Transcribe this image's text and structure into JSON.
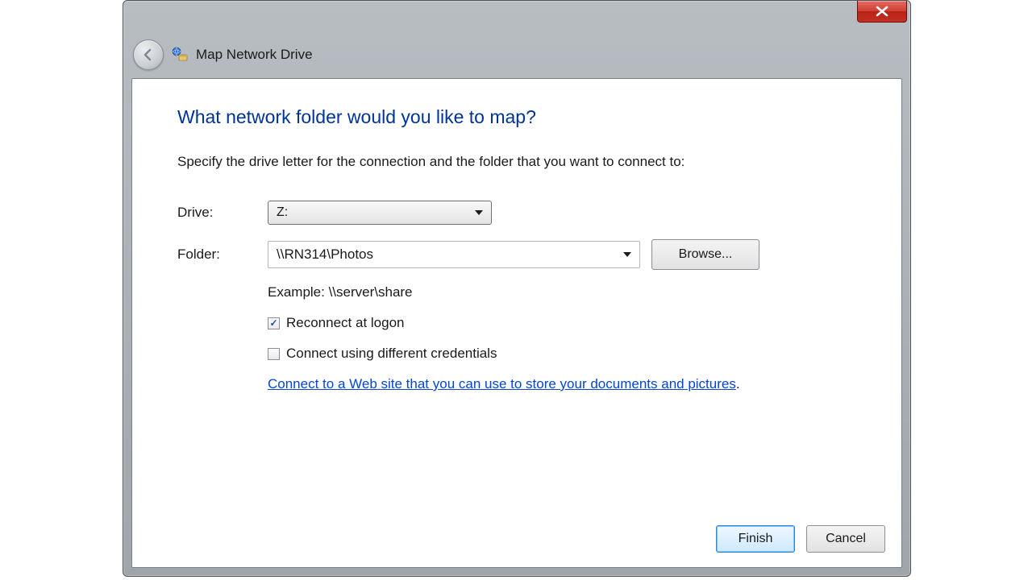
{
  "window": {
    "title": "Map Network Drive"
  },
  "content": {
    "heading": "What network folder would you like to map?",
    "instructions": "Specify the drive letter for the connection and the folder that you want to connect to:",
    "drive_label": "Drive:",
    "drive_value": "Z:",
    "folder_label": "Folder:",
    "folder_value": "\\\\RN314\\Photos",
    "browse_label": "Browse...",
    "example_text": "Example: \\\\server\\share",
    "reconnect_label": "Reconnect at logon",
    "reconnect_checked": true,
    "diff_creds_label": "Connect using different credentials",
    "diff_creds_checked": false,
    "web_link_text": "Connect to a Web site that you can use to store your documents and pictures",
    "web_link_trailing": "."
  },
  "footer": {
    "finish_label": "Finish",
    "cancel_label": "Cancel"
  }
}
